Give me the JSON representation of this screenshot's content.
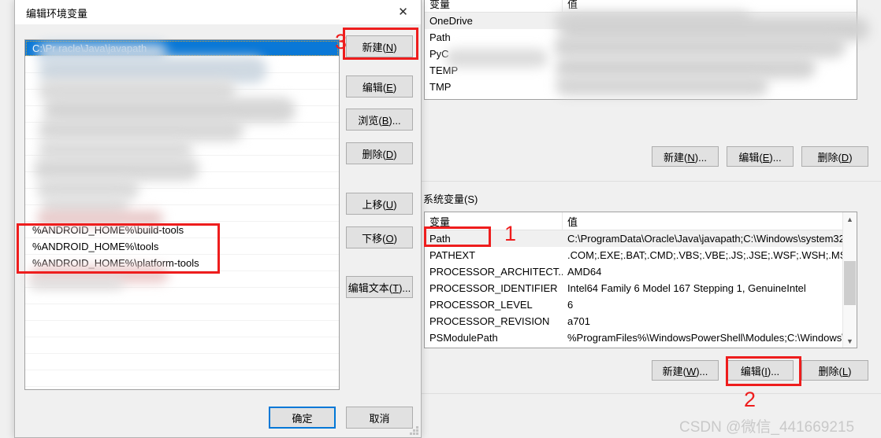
{
  "dialog": {
    "title": "编辑环境变量",
    "close_icon": "close-icon",
    "list_items": [
      {
        "text": "C:\\Pr              racle\\Java\\javapath",
        "selected": true,
        "redacted": false
      },
      {
        "text": "",
        "selected": false,
        "redacted": true
      },
      {
        "text": "",
        "selected": false,
        "redacted": true
      },
      {
        "text": "",
        "selected": false,
        "redacted": true
      },
      {
        "text": "",
        "selected": false,
        "redacted": true
      },
      {
        "text": "",
        "selected": false,
        "redacted": true
      },
      {
        "text": "",
        "selected": false,
        "redacted": true
      },
      {
        "text": "",
        "selected": false,
        "redacted": true
      },
      {
        "text": "",
        "selected": false,
        "redacted": true
      },
      {
        "text": "",
        "selected": false,
        "redacted": true
      },
      {
        "text": "",
        "selected": false,
        "redacted": true
      },
      {
        "text": "%ANDROID_HOME%\\build-tools",
        "selected": false,
        "redacted": false
      },
      {
        "text": "%ANDROID_HOME%\\tools",
        "selected": false,
        "redacted": false
      },
      {
        "text": "%ANDROID_HOME%\\platform-tools",
        "selected": false,
        "redacted": false
      },
      {
        "text": "",
        "selected": false,
        "redacted": true
      }
    ],
    "buttons": {
      "new": "新建(N)",
      "edit": "编辑(E)",
      "browse": "浏览(B)...",
      "delete": "删除(D)",
      "move_up": "上移(U)",
      "move_down": "下移(O)",
      "edit_text": "编辑文本(T)..."
    },
    "ok": "确定",
    "cancel": "取消"
  },
  "user_vars": {
    "headers": {
      "name": "变量",
      "value": "值"
    },
    "rows": [
      {
        "name": "OneDrive",
        "value": ""
      },
      {
        "name": "Path",
        "value": ""
      },
      {
        "name": "PyC",
        "value": ""
      },
      {
        "name": "TEMP",
        "value": ""
      },
      {
        "name": "TMP",
        "value": ""
      }
    ],
    "buttons": {
      "new": "新建(N)...",
      "edit": "编辑(E)...",
      "delete": "删除(D)"
    }
  },
  "system_vars": {
    "label": "系统变量(S)",
    "headers": {
      "name": "变量",
      "value": "值"
    },
    "rows": [
      {
        "name": "Path",
        "value": "C:\\ProgramData\\Oracle\\Java\\javapath;C:\\Windows\\system32;..."
      },
      {
        "name": "PATHEXT",
        "value": ".COM;.EXE;.BAT;.CMD;.VBS;.VBE;.JS;.JSE;.WSF;.WSH;.MSC"
      },
      {
        "name": "PROCESSOR_ARCHITECT...",
        "value": "AMD64"
      },
      {
        "name": "PROCESSOR_IDENTIFIER",
        "value": "Intel64 Family 6 Model 167 Stepping 1, GenuineIntel"
      },
      {
        "name": "PROCESSOR_LEVEL",
        "value": "6"
      },
      {
        "name": "PROCESSOR_REVISION",
        "value": "a701"
      },
      {
        "name": "PSModulePath",
        "value": "%ProgramFiles%\\WindowsPowerShell\\Modules;C:\\Windows\\..."
      }
    ],
    "buttons": {
      "new": "新建(W)...",
      "edit": "编辑(I)...",
      "delete": "删除(L)"
    }
  },
  "annotations": {
    "one": "1",
    "two": "2",
    "three": "3",
    "color": "#ee1d1d"
  },
  "watermark": "CSDN @微信_441669215"
}
